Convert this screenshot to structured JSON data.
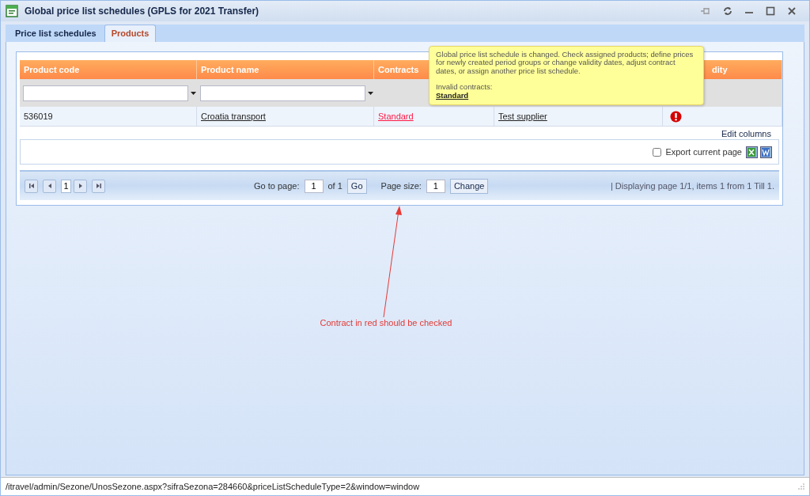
{
  "window": {
    "title": "Global price list schedules (GPLS for 2021 Transfer)"
  },
  "tabs": [
    {
      "label": "Price list schedules",
      "selected": false
    },
    {
      "label": "Products",
      "selected": true
    }
  ],
  "table": {
    "columns": [
      {
        "label": "Product code",
        "filter": true
      },
      {
        "label": "Product name",
        "filter": true
      },
      {
        "label": "Contracts",
        "filter": false
      },
      {},
      {
        "label": "dity",
        "filter": false
      }
    ],
    "rows": [
      {
        "cells": [
          {
            "kind": "text",
            "text": "536019"
          },
          {
            "kind": "link",
            "text": "Croatia transport"
          },
          {
            "kind": "invalid-link",
            "text": "Standard"
          },
          {
            "kind": "link",
            "text": "Test supplier"
          },
          {
            "kind": "error"
          }
        ]
      }
    ]
  },
  "tooltip": {
    "message": "Global price list schedule is changed. Check assigned products; define prices for newly created period groups or change validity dates, adjust contract dates, or assign another price list schedule.",
    "label": "Invalid contracts:",
    "link": "Standard"
  },
  "edit_columns": "Edit columns",
  "export": {
    "label": "Export current page",
    "checked": false
  },
  "pager": {
    "current_page": "1",
    "go_label": "Go to page:",
    "page_value": "1",
    "of": "of 1",
    "go_button": "Go",
    "size_label": "Page size:",
    "size_value": "1",
    "change_button": "Change",
    "summary": "| Displaying page  1/1,  items  1  from  1  Till  1."
  },
  "annotation": "Contract in red should be checked",
  "status_bar": {
    "url": "/itravel/admin/Sezone/UnosSezone.aspx?sifraSezona=284660&priceListScheduleType=2&window=window"
  }
}
